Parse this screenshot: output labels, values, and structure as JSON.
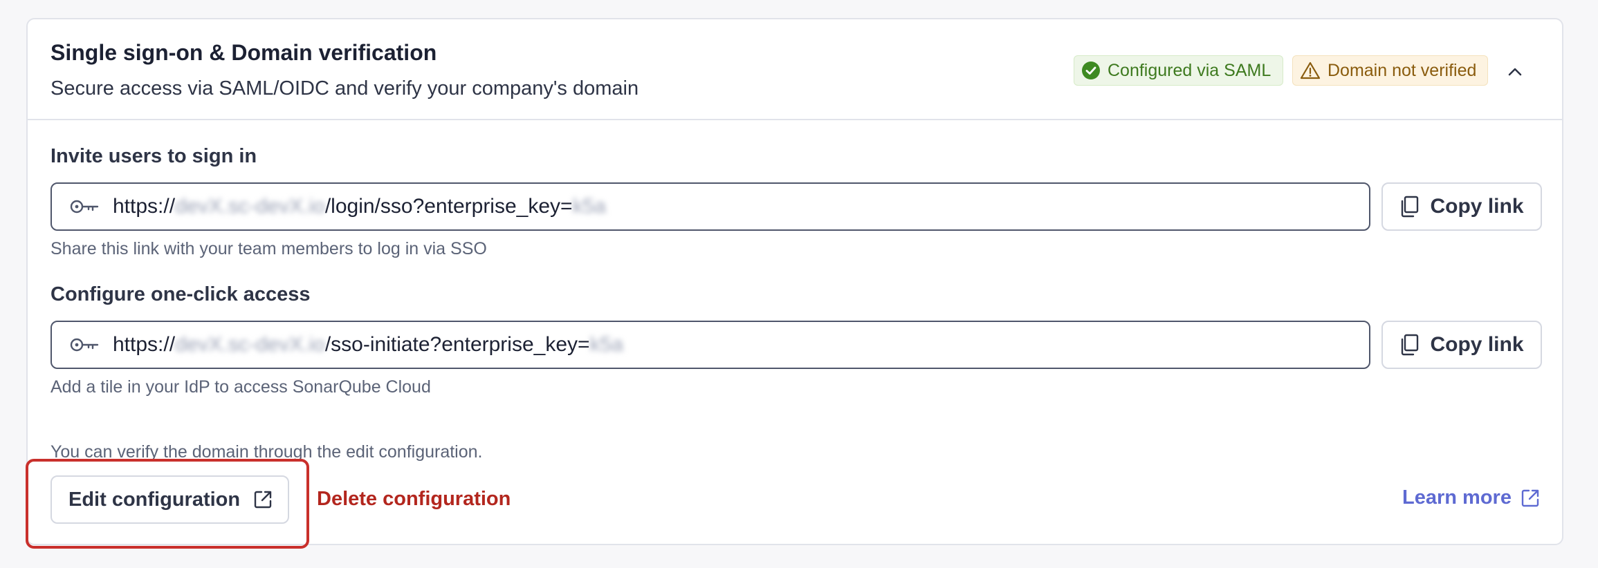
{
  "header": {
    "title": "Single sign-on & Domain verification",
    "subtitle": "Secure access via SAML/OIDC and verify your company's domain",
    "badges": [
      {
        "label": "Configured via SAML",
        "status": "success",
        "icon": "check-circle-icon",
        "color": "#3e7a1f"
      },
      {
        "label": "Domain not verified",
        "status": "warning",
        "icon": "warning-triangle-icon",
        "color": "#8a5c0e"
      }
    ],
    "collapse_icon": "chevron-up-icon"
  },
  "invite": {
    "label": "Invite users to sign in",
    "url_prefix": "https://",
    "url_path": "/login/sso?enterprise_key=",
    "helper": "Share this link with your team members to log in via SSO",
    "copy_label": "Copy link"
  },
  "one_click": {
    "label": "Configure one-click access",
    "url_prefix": "https://",
    "url_path": "/sso-initiate?enterprise_key=",
    "helper": "Add a tile in your IdP to access SonarQube Cloud",
    "copy_label": "Copy link"
  },
  "footer": {
    "note": "You can verify the domain through the edit configuration.",
    "edit_label": "Edit configuration",
    "delete_label": "Delete configuration",
    "learn_more_label": "Learn more"
  },
  "colors": {
    "danger": "#b3261e",
    "link": "#5e6ad2",
    "highlight": "#c9302c"
  }
}
